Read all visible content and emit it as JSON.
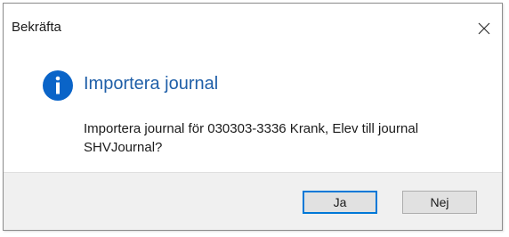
{
  "window": {
    "title": "Bekräfta",
    "close_icon": "close-icon"
  },
  "content": {
    "icon": "info-icon",
    "heading": "Importera journal",
    "message_line1": "Importera journal för 030303-3336 Krank, Elev till journal",
    "message_line2": "SHVJournal?"
  },
  "buttons": {
    "yes_label": "Ja",
    "no_label": "Nej"
  },
  "colors": {
    "heading": "#1f5fa8",
    "info_icon": "#0a64c8",
    "default_button_border": "#0078d7",
    "footer_bg": "#f0f0f0"
  }
}
